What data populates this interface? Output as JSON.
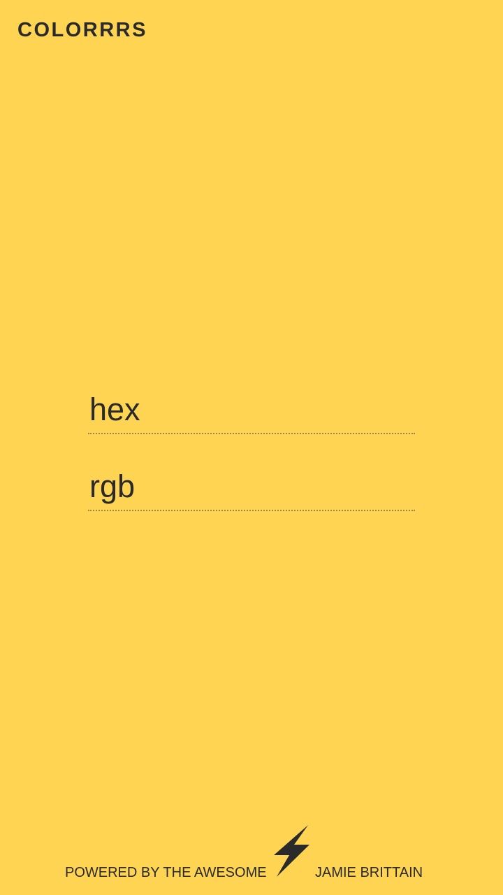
{
  "app": {
    "logo": "COLORRRS"
  },
  "form": {
    "hex_placeholder": "hex",
    "rgb_placeholder": "rgb"
  },
  "footer": {
    "powered_text": "POWERED BY THE AWESOME",
    "icon": "lightning-bolt-icon",
    "author": "JAMIE BRITTAIN"
  },
  "colors": {
    "background": "#FED452",
    "text": "#2a2a2a"
  }
}
